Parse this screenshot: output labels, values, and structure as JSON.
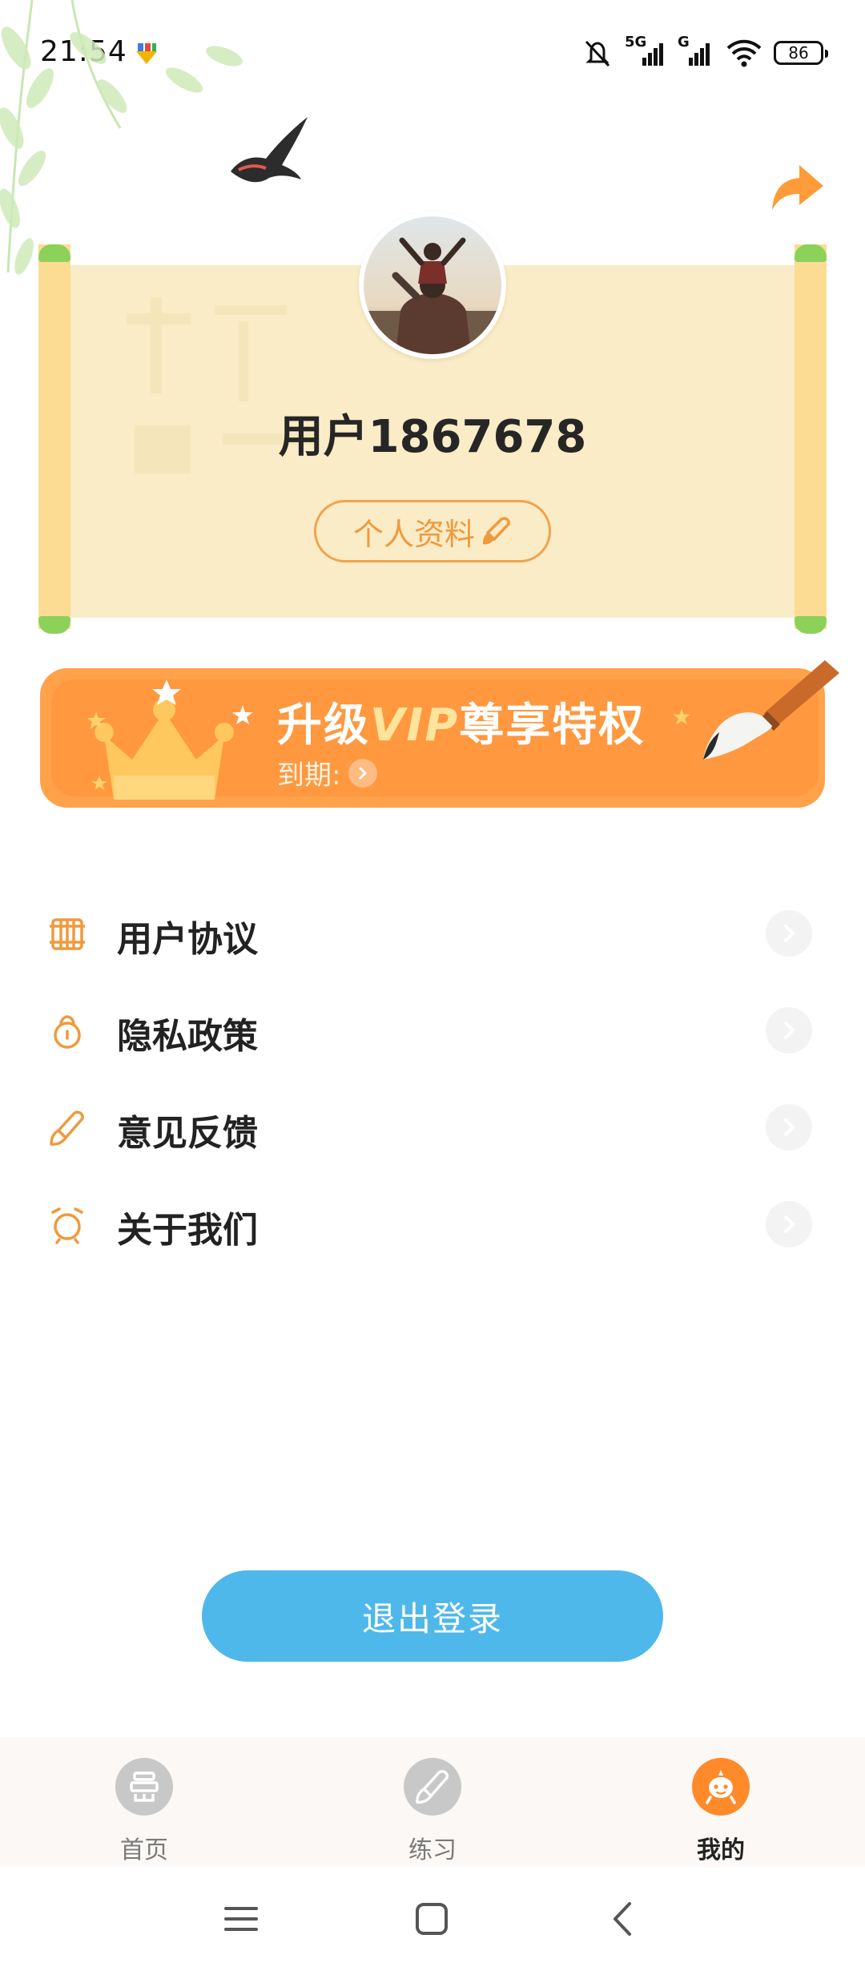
{
  "status_bar": {
    "time": "21:54",
    "network_label_1": "5G",
    "network_label_2": "G",
    "battery": "86",
    "icons": [
      "download-icon",
      "mute-icon",
      "signal-icon",
      "wifi-icon",
      "battery-icon"
    ]
  },
  "profile": {
    "username": "用户1867678",
    "edit_button_label": "个人资料"
  },
  "vip": {
    "title_prefix": "升级",
    "title_vip": "VIP",
    "title_suffix": "尊享特权",
    "expire_label": "到期:"
  },
  "menu": {
    "items": [
      {
        "label": "用户协议",
        "icon": "agreement-icon"
      },
      {
        "label": "隐私政策",
        "icon": "lock-icon"
      },
      {
        "label": "意见反馈",
        "icon": "brush-icon"
      },
      {
        "label": "关于我们",
        "icon": "alarm-icon"
      }
    ]
  },
  "logout": {
    "label": "退出登录"
  },
  "bottom_nav": {
    "tabs": [
      {
        "label": "首页",
        "active": false
      },
      {
        "label": "练习",
        "active": false
      },
      {
        "label": "我的",
        "active": true
      }
    ]
  },
  "colors": {
    "accent": "#ff983f",
    "scroll_paper": "#f9ecc6",
    "logout_blue": "#4fb8ea",
    "inactive_nav": "#7a7a7a"
  }
}
